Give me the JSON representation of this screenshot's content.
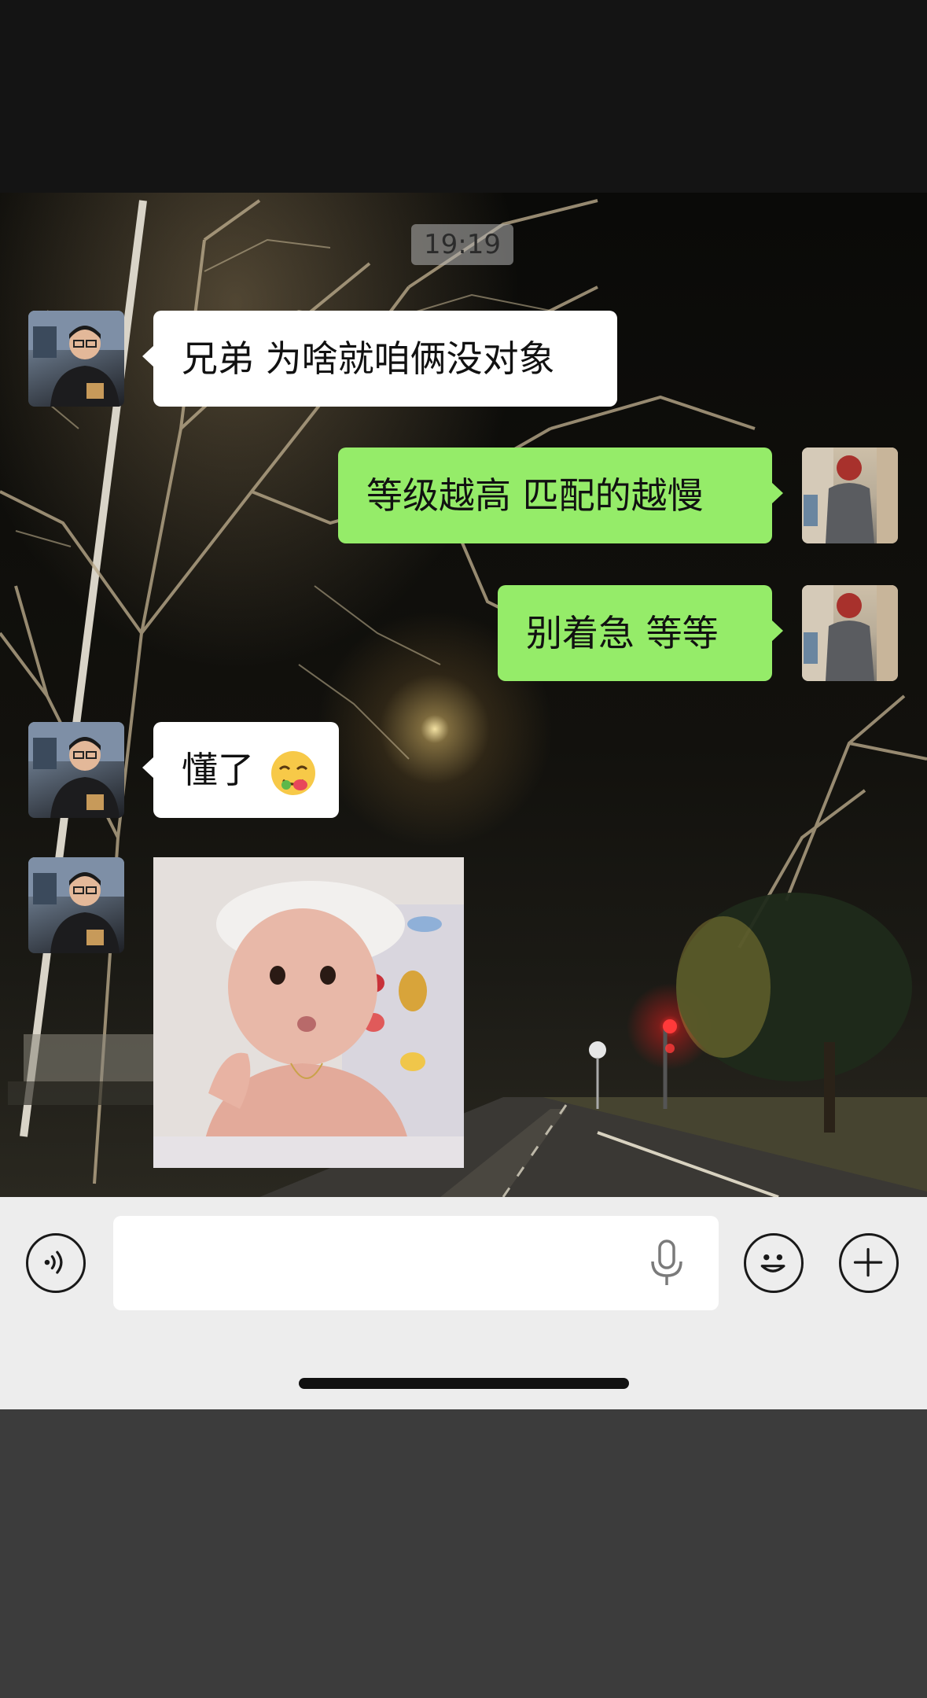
{
  "chat": {
    "timestamp": "19:19",
    "messages": [
      {
        "sender": "friend",
        "type": "text",
        "text": "兄弟 为啥就咱俩没对象"
      },
      {
        "sender": "me",
        "type": "text",
        "text": "等级越高 匹配的越慢"
      },
      {
        "sender": "me",
        "type": "text",
        "text": "别着急  等等"
      },
      {
        "sender": "friend",
        "type": "text",
        "text": "懂了",
        "emoji": "yum-face-emoji"
      },
      {
        "sender": "friend",
        "type": "sticker",
        "sticker": "baby-photo-sticker"
      }
    ]
  },
  "input_bar": {
    "voice_icon": "voice-wave-icon",
    "text_value": "",
    "mic_icon": "microphone-icon",
    "emoji_icon": "smiley-face-icon",
    "plus_icon": "plus-icon"
  },
  "colors": {
    "incoming_bubble": "#ffffff",
    "outgoing_bubble": "#95ec69",
    "input_bar_bg": "#ededed"
  }
}
